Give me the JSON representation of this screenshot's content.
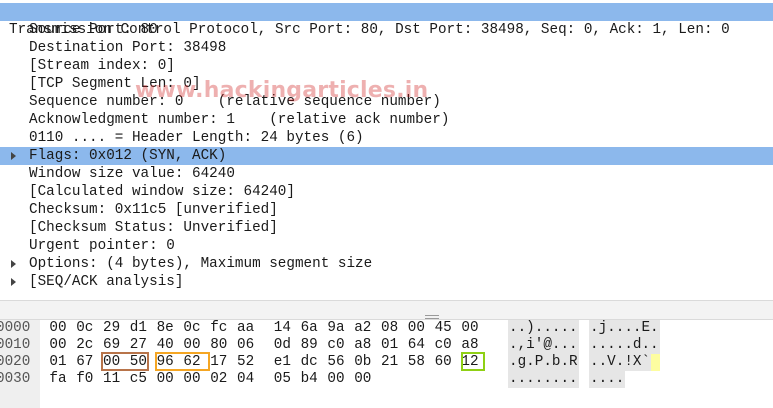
{
  "tree": {
    "header": "Transmission Control Protocol, Src Port: 80, Dst Port: 38498, Seq: 0, Ack: 1, Len: 0",
    "fields": [
      {
        "text": "Source Port: 80",
        "expand": false,
        "selected": false
      },
      {
        "text": "Destination Port: 38498",
        "expand": false,
        "selected": false
      },
      {
        "text": "[Stream index: 0]",
        "expand": false,
        "selected": false
      },
      {
        "text": "[TCP Segment Len: 0]",
        "expand": false,
        "selected": false
      },
      {
        "text": "Sequence number: 0    (relative sequence number)",
        "expand": false,
        "selected": false
      },
      {
        "text": "Acknowledgment number: 1    (relative ack number)",
        "expand": false,
        "selected": false
      },
      {
        "text": "0110 .... = Header Length: 24 bytes (6)",
        "expand": false,
        "selected": false
      },
      {
        "text": "Flags: 0x012 (SYN, ACK)",
        "expand": true,
        "selected": true
      },
      {
        "text": "Window size value: 64240",
        "expand": false,
        "selected": false
      },
      {
        "text": "[Calculated window size: 64240]",
        "expand": false,
        "selected": false
      },
      {
        "text": "Checksum: 0x11c5 [unverified]",
        "expand": false,
        "selected": false
      },
      {
        "text": "[Checksum Status: Unverified]",
        "expand": false,
        "selected": false
      },
      {
        "text": "Urgent pointer: 0",
        "expand": false,
        "selected": false
      },
      {
        "text": "Options: (4 bytes), Maximum segment size",
        "expand": true,
        "selected": false
      },
      {
        "text": "[SEQ/ACK analysis]",
        "expand": true,
        "selected": false
      }
    ]
  },
  "watermark": "www.hackingarticles.in",
  "hex": {
    "rows": [
      {
        "offset": "0000",
        "bytes": [
          "00",
          "0c",
          "29",
          "d1",
          "8e",
          "0c",
          "fc",
          "aa",
          "14",
          "6a",
          "9a",
          "a2",
          "08",
          "00",
          "45",
          "00"
        ],
        "ascii1": "..).....",
        "ascii2": ".j....E."
      },
      {
        "offset": "0010",
        "bytes": [
          "00",
          "2c",
          "69",
          "27",
          "40",
          "00",
          "80",
          "06",
          "0d",
          "89",
          "c0",
          "a8",
          "01",
          "64",
          "c0",
          "a8"
        ],
        "ascii1": ".,i'@...",
        "ascii2": ".....d.."
      },
      {
        "offset": "0020",
        "bytes": [
          "01",
          "67",
          "00",
          "50",
          "96",
          "62",
          "17",
          "52",
          "e1",
          "dc",
          "56",
          "0b",
          "21",
          "58",
          "60",
          "12"
        ],
        "ascii1": ".g.P.b.R",
        "ascii2": "..V.!X`."
      },
      {
        "offset": "0030",
        "bytes": [
          "fa",
          "f0",
          "11",
          "c5",
          "00",
          "00",
          "02",
          "04",
          "05",
          "b4",
          "00",
          "00"
        ],
        "ascii1": "........",
        "ascii2": "...."
      }
    ]
  },
  "colors": {
    "selection": "#8cb8ec",
    "highlight_source_port": "#b8744a",
    "highlight_dest_port": "#f5a623",
    "highlight_flags": "#8fd014",
    "selected_byte_bg": "#fdfda0"
  }
}
